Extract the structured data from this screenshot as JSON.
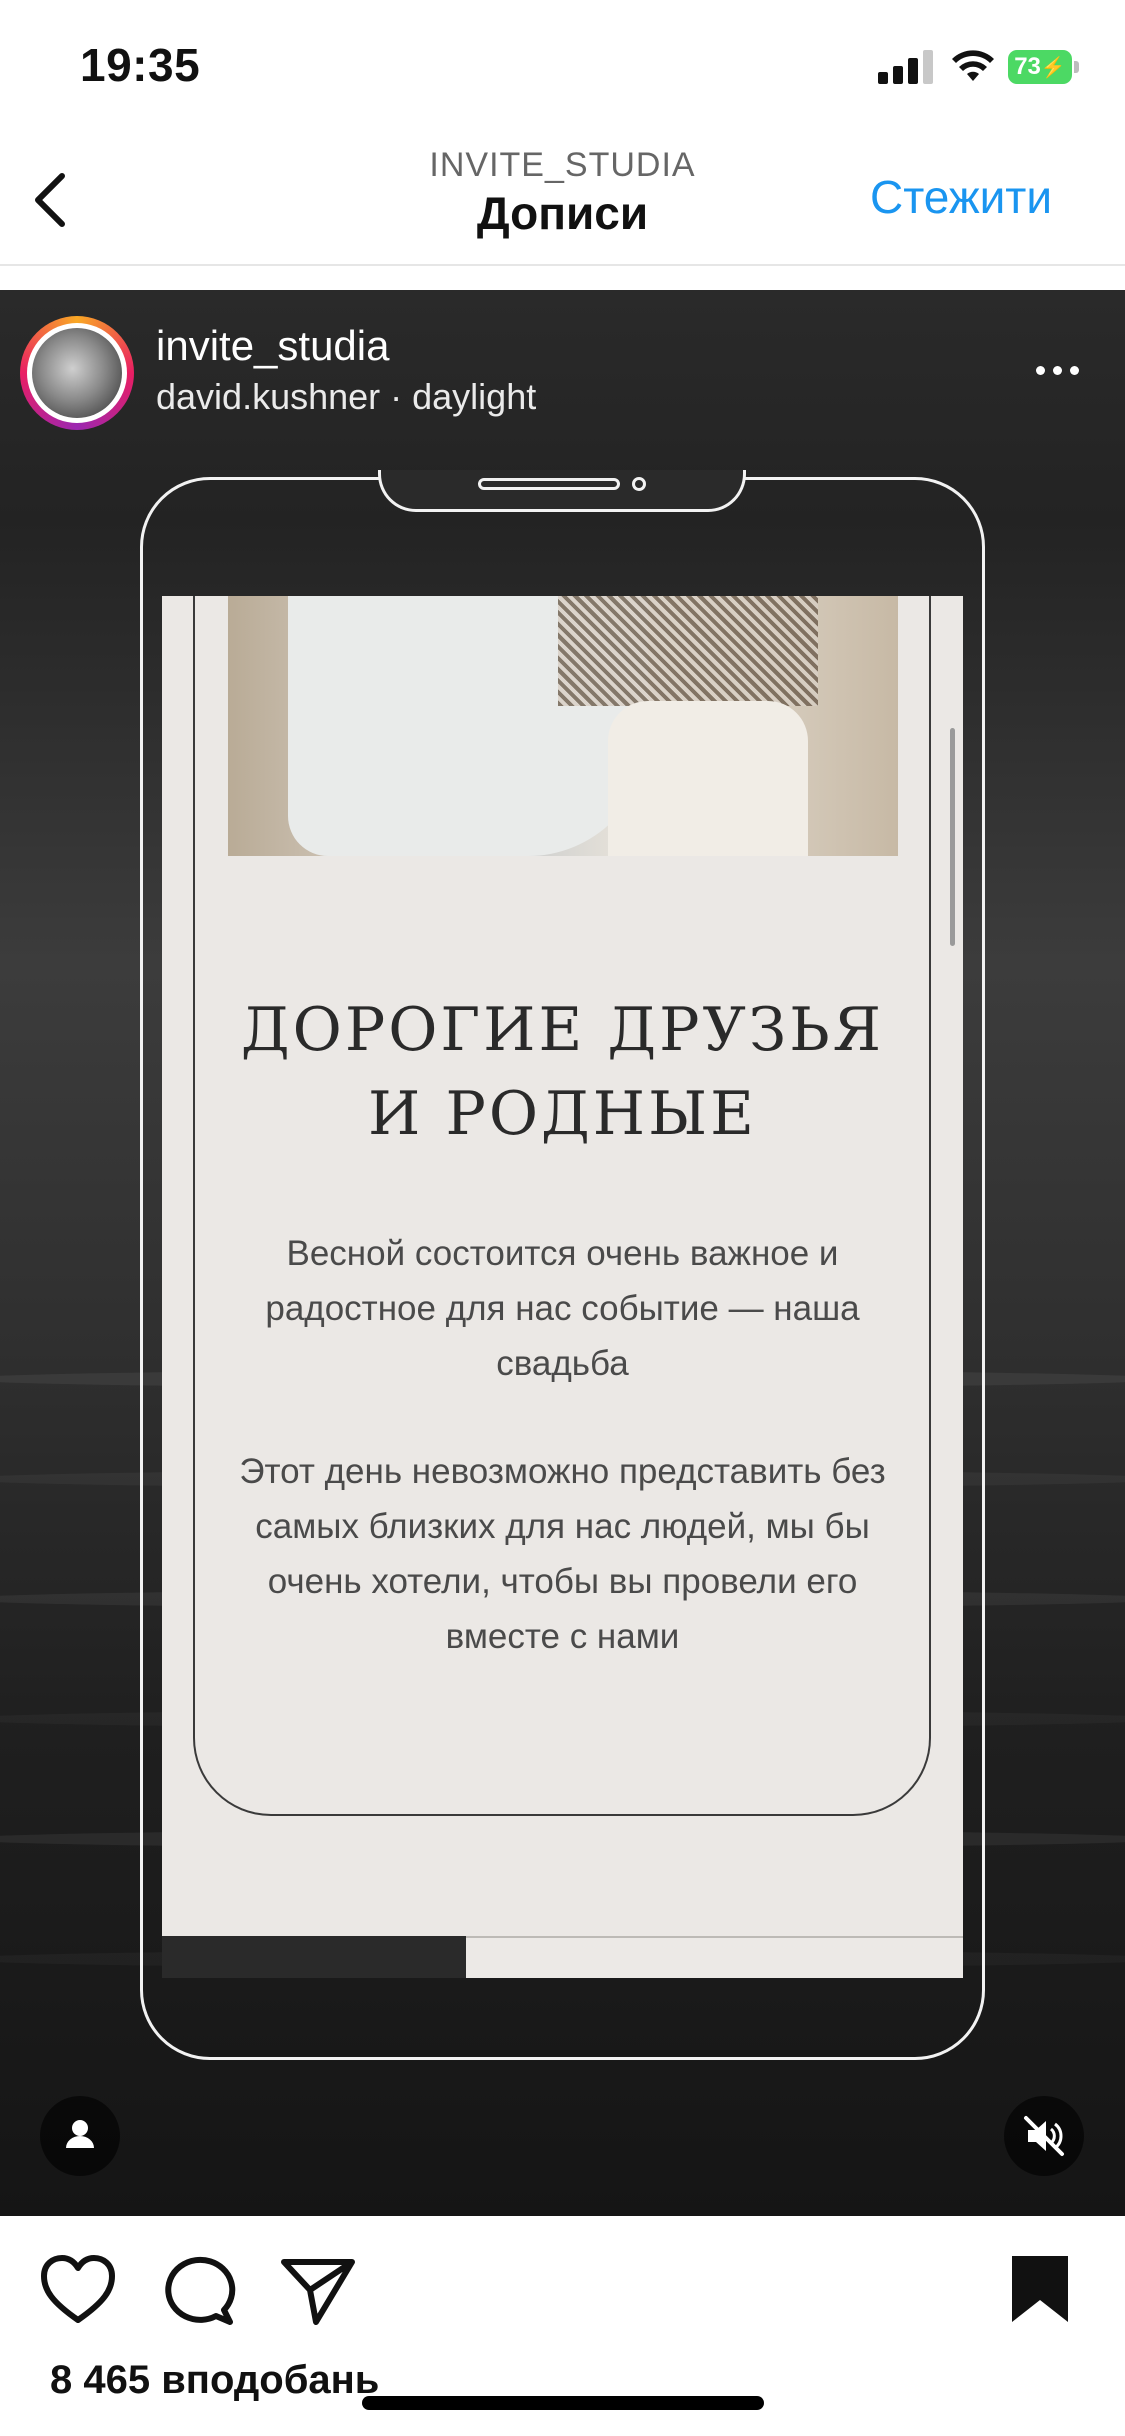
{
  "status_bar": {
    "time": "19:35",
    "battery": "73"
  },
  "header": {
    "subtitle": "INVITE_STUDIA",
    "title": "Дописи",
    "follow_label": "Стежити"
  },
  "post": {
    "username": "invite_studia",
    "audio": "david.kushner · daylight",
    "invite": {
      "heading_line1": "ДОРОГИЕ ДРУЗЬЯ",
      "heading_line2": "И РОДНЫЕ",
      "paragraph1": "Весной состоится очень важное и радостное для нас событие — наша свадьба",
      "paragraph2": "Этот день невозможно представить без самых близких для нас людей, мы бы очень хотели, чтобы вы провели его вместе с нами"
    },
    "video_progress": 0.38,
    "likes": "8 465 вподобань"
  },
  "colors": {
    "accent": "#1a95f0",
    "battery": "#4cd964"
  },
  "icons": [
    "back-icon",
    "signal-icon",
    "wifi-icon",
    "battery-icon",
    "more-icon",
    "user-tag-icon",
    "mute-icon",
    "heart-icon",
    "comment-icon",
    "share-icon",
    "bookmark-icon"
  ]
}
